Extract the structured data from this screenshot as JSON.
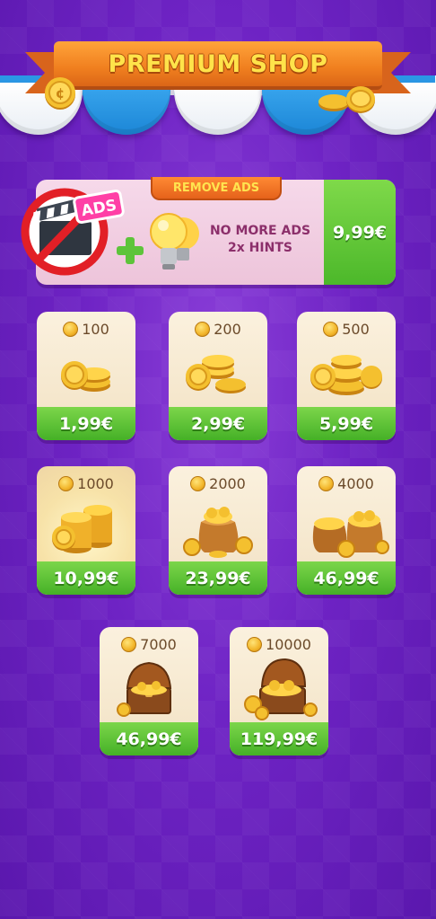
{
  "header": {
    "title": "PREMIUM SHOP"
  },
  "remove_ads": {
    "tab_label": "REMOVE ADS",
    "badge_text": "ADS",
    "line1": "NO MORE ADS",
    "line2": "2x HINTS",
    "price": "9,99€"
  },
  "products": [
    {
      "amount": "100",
      "price": "1,99€",
      "icon": "coins-small-icon"
    },
    {
      "amount": "200",
      "price": "2,99€",
      "icon": "coins-pile-icon"
    },
    {
      "amount": "500",
      "price": "5,99€",
      "icon": "coins-large-pile-icon"
    },
    {
      "amount": "1000",
      "price": "10,99€",
      "icon": "coin-stacks-icon"
    },
    {
      "amount": "2000",
      "price": "23,99€",
      "icon": "coin-sack-icon"
    },
    {
      "amount": "4000",
      "price": "46,99€",
      "icon": "coin-sacks-icon"
    },
    {
      "amount": "7000",
      "price": "46,99€",
      "icon": "treasure-chest-icon"
    },
    {
      "amount": "10000",
      "price": "119,99€",
      "icon": "treasure-chest-large-icon"
    }
  ],
  "colors": {
    "background": "#6e23c4",
    "banner": "#f07f1f",
    "title": "#ffe34a",
    "price_green": "#4cb82a",
    "card": "#f8ecd4"
  }
}
